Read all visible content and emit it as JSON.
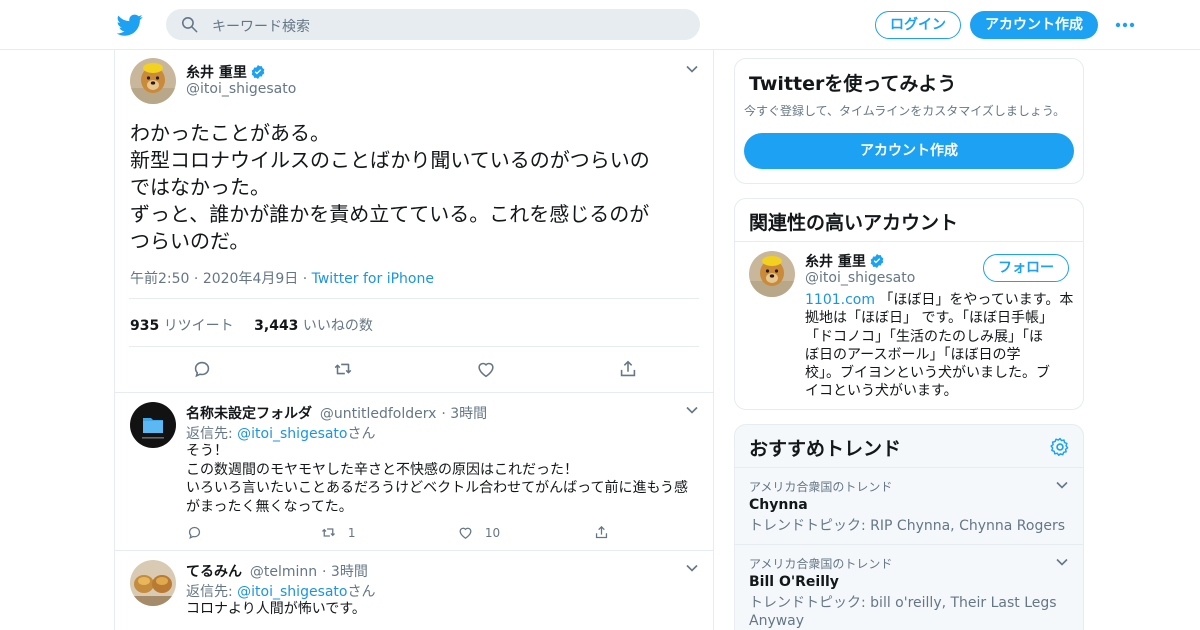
{
  "colors": {
    "accent": "#1da1f2",
    "link": "#1b95e0",
    "muted": "#657786",
    "border": "#e6ecf0"
  },
  "header": {
    "logo_icon": "twitter-bird-icon",
    "search_placeholder": "キーワード検索",
    "login_label": "ログイン",
    "signup_label": "アカウント作成",
    "more_icon": "more-dots-icon"
  },
  "main_tweet": {
    "name": "糸井 重里",
    "handle": "@itoi_shigesato",
    "text_lines": [
      "わかったことがある。",
      "新型コロナウイルスのことばかり聞いているのがつらいの",
      "ではなかった。",
      "ずっと、誰かが誰かを責め立てている。これを感じるのが",
      "つらいのだ。"
    ],
    "time": "午前2:50",
    "date": "2020年4月9日",
    "source": "Twitter for iPhone",
    "retweet_count": "935",
    "retweet_label": "リツイート",
    "like_count": "3,443",
    "like_label": "いいねの数"
  },
  "replies": [
    {
      "name": "名称未設定フォルダ",
      "handle": "@untitledfolderx",
      "time": "3時間",
      "reply_prefix": "返信先: ",
      "reply_to": "@itoi_shigesato",
      "reply_suffix": "さん",
      "text_lines": [
        "そう！",
        "この数週間のモヤモヤした辛さと不快感の原因はこれだった！",
        "いろいろ言いたいことあるだろうけどベクトル合わせてがんばって前に進もう感",
        "がまったく無くなってた。"
      ],
      "retweets": "1",
      "likes": "10"
    },
    {
      "name": "てるみん",
      "handle": "@telminn",
      "time": "3時間",
      "reply_prefix": "返信先: ",
      "reply_to": "@itoi_shigesato",
      "reply_suffix": "さん",
      "text_lines": [
        "コロナより人間が怖いです。"
      ]
    }
  ],
  "signup_card": {
    "title": "Twitterを使ってみよう",
    "subtitle": "今すぐ登録して、タイムラインをカスタマイズしましょう。",
    "button": "アカウント作成"
  },
  "related_card": {
    "title": "関連性の高いアカウント",
    "name": "糸井 重里",
    "handle": "@itoi_shigesato",
    "follow": "フォロー",
    "bio_link": "1101.com",
    "bio_lines": [
      " 「ほぼ日」をやっています。本",
      "拠地は「ほぼ日」 です。「ほぼ日手帳」",
      "「ドコノコ」「生活のたのしみ展」「ほ",
      "ぼ日のアースボール」「ほぼ日の学",
      "校」。ブイヨンという犬がいました。ブ",
      "イコという犬がいます。"
    ]
  },
  "trends_card": {
    "title": "おすすめトレンド",
    "settings_icon": "gear-icon",
    "items": [
      {
        "meta": "アメリカ合衆国のトレンド",
        "name": "Chynna",
        "topic_lines": [
          "トレンドトピック: RIP Chynna, Chynna Rogers"
        ]
      },
      {
        "meta": "アメリカ合衆国のトレンド",
        "name": "Bill O'Reilly",
        "topic_lines": [
          "トレンドトピック: bill o'reilly, Their Last Legs",
          "Anyway"
        ]
      }
    ]
  }
}
